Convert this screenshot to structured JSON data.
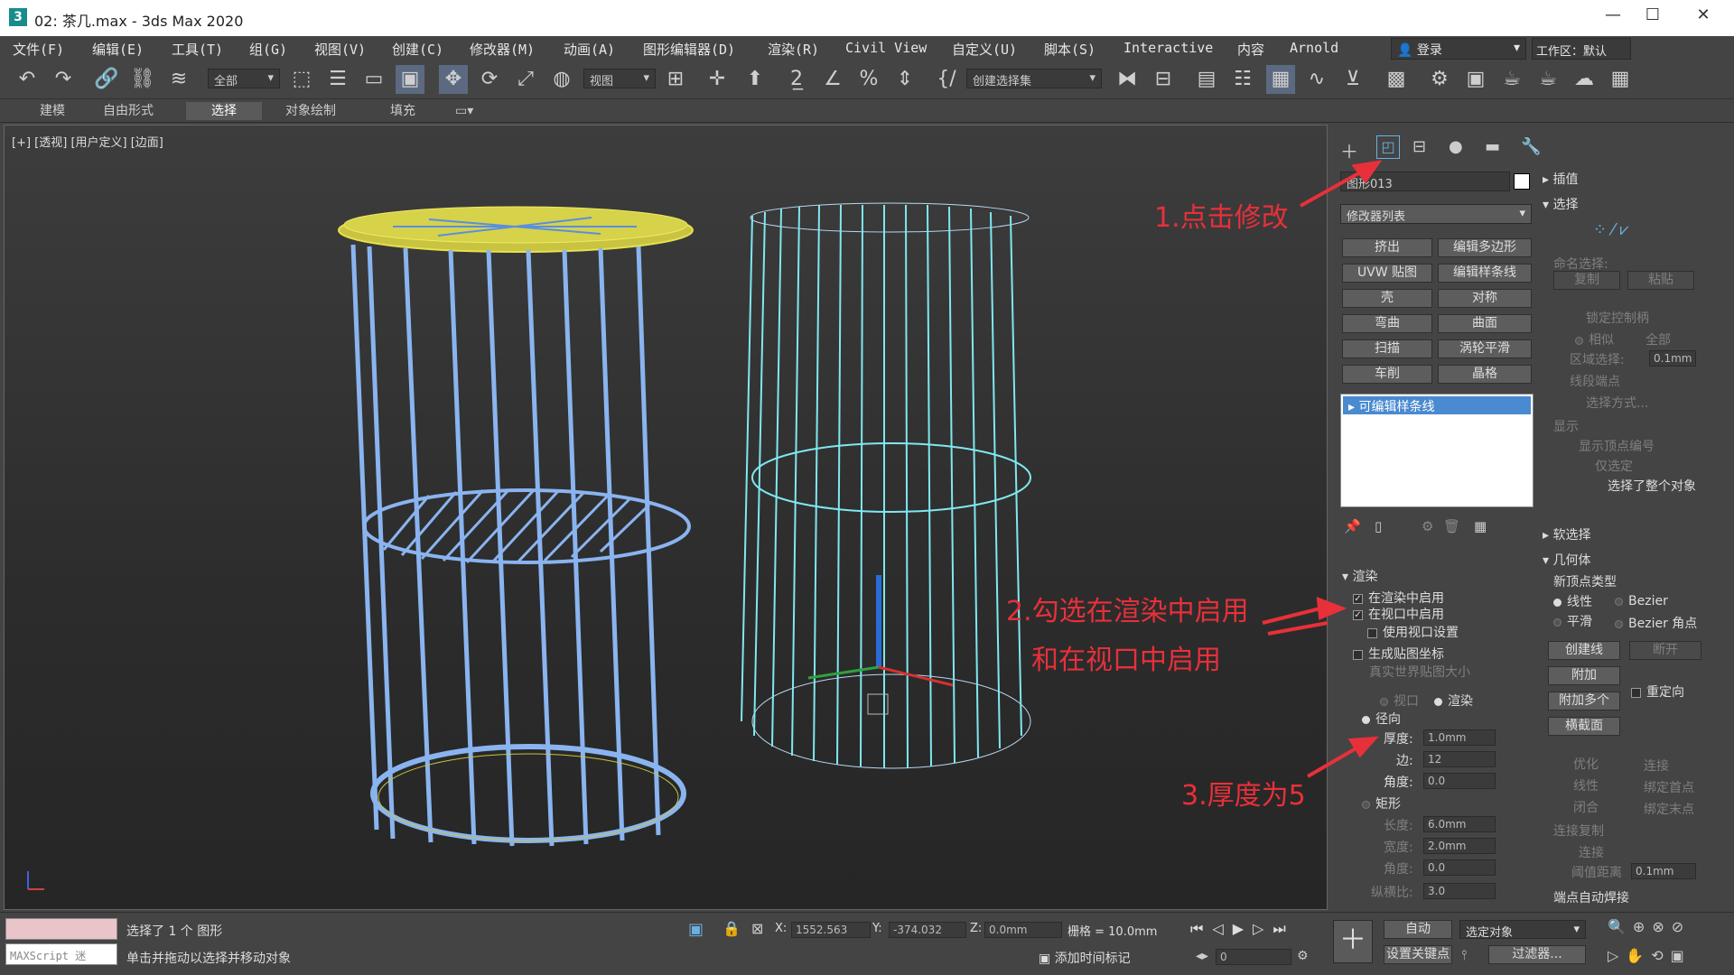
{
  "window": {
    "title": "02: 茶几.max - 3ds Max 2020",
    "app_icon": "3ds-max-icon"
  },
  "menu": [
    "文件(F)",
    "编辑(E)",
    "工具(T)",
    "组(G)",
    "视图(V)",
    "创建(C)",
    "修改器(M)",
    "动画(A)",
    "图形编辑器(D)",
    "渲染(R)",
    "Civil View",
    "自定义(U)",
    "脚本(S)",
    "Interactive",
    "内容",
    "Arnold"
  ],
  "account": {
    "label": "登录",
    "workspace": "工作区：默认"
  },
  "toolbar": {
    "selection_filter": "全部",
    "ref_coord": "视图",
    "named_set": "创建选择集"
  },
  "ribbon": {
    "tabs": [
      "建模",
      "自由形式",
      "选择",
      "对象绘制",
      "填充"
    ],
    "active": "选择"
  },
  "viewport": {
    "label": "[+] [透视] [用户定义] [边面]"
  },
  "command_panel": {
    "object_name": "图形013",
    "modifier_list": "修改器列表",
    "modifier_buttons": [
      "挤出",
      "编辑多边形",
      "UVW 贴图",
      "编辑样条线",
      "壳",
      "对称",
      "弯曲",
      "曲面",
      "扫描",
      "涡轮平滑",
      "车削",
      "晶格"
    ],
    "stack_item": "可编辑样条线",
    "rendering": {
      "title": "渲染",
      "enable_in_renderer": "在渲染中启用",
      "enable_in_viewport": "在视口中启用",
      "use_viewport_settings": "使用视口设置",
      "gen_mapping": "生成贴图坐标",
      "real_world": "真实世界贴图大小",
      "viewport_opt": "视口",
      "render_opt": "渲染",
      "radial": "径向",
      "thickness_label": "厚度:",
      "thickness": "1.0mm",
      "sides_label": "边:",
      "sides": "12",
      "angle_label": "角度:",
      "angle": "0.0",
      "rectangular": "矩形",
      "length_label": "长度:",
      "length": "6.0mm",
      "width_label": "宽度:",
      "width": "2.0mm",
      "rect_angle_label": "角度:",
      "rect_angle": "0.0",
      "aspect_label": "纵横比:",
      "aspect": "3.0"
    }
  },
  "right_panel": {
    "interpolation": "插值",
    "selection": "选择",
    "named_sel": "命名选择:",
    "copy": "复制",
    "paste": "粘贴",
    "lock_handles": "锁定控制柄",
    "alike": "相似",
    "all": "全部",
    "area_sel": "区域选择:",
    "area_val": "0.1mm",
    "segment_end": "线段端点",
    "select_by": "选择方式...",
    "display": "显示",
    "show_vert_num": "显示顶点编号",
    "only_selected": "仅选定",
    "selected_info": "选择了整个对象",
    "soft_selection": "软选择",
    "geometry": "几何体",
    "new_vertex_type": "新顶点类型",
    "linear": "线性",
    "bezier": "Bezier",
    "smooth": "平滑",
    "bezier_corner": "Bezier 角点",
    "create_line": "创建线",
    "break": "断开",
    "attach": "附加",
    "attach_multi": "附加多个",
    "reorient": "重定向",
    "cross_section": "横截面",
    "refine": "优化",
    "connect": "连接",
    "linear2": "线性",
    "bind_first": "绑定首点",
    "closed": "闭合",
    "bind_last": "绑定末点",
    "connect_copy": "连接复制",
    "connect2": "连接",
    "threshold": "阈值距离",
    "threshold_val": "0.1mm",
    "auto_weld": "端点自动焊接"
  },
  "annotations": [
    "1.点击修改",
    "2.勾选在渲染中启用",
    "和在视口中启用",
    "3.厚度为5"
  ],
  "status": {
    "maxscript": "MAXScript 迷",
    "selected": "选择了 1 个 图形",
    "prompt": "单击并拖动以选择并移动对象",
    "x_label": "X:",
    "x": "1552.563",
    "y_label": "Y:",
    "y": "-374.032",
    "z_label": "Z:",
    "z": "0.0mm",
    "grid": "栅格 = 10.0mm",
    "add_time_tag": "添加时间标记",
    "auto": "自动",
    "selected_obj": "选定对象",
    "set_key": "设置关键点",
    "filters": "过滤器...",
    "frame": "0"
  }
}
